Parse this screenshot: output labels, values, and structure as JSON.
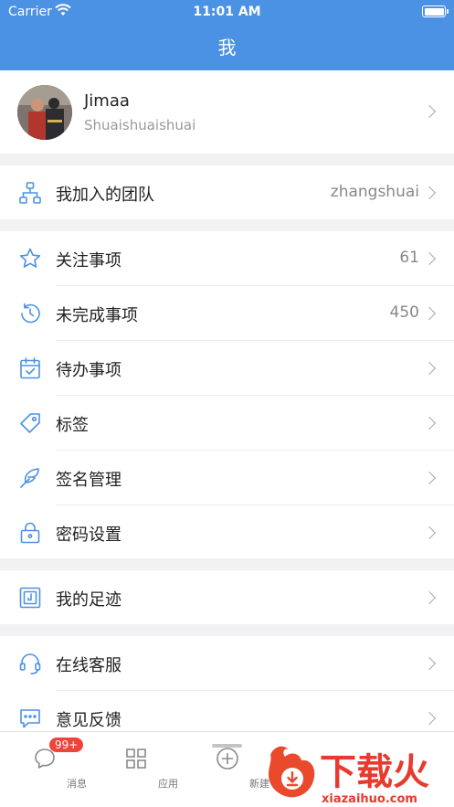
{
  "status_bar": {
    "carrier": "Carrier",
    "time": "11:01 AM"
  },
  "nav": {
    "title": "我"
  },
  "profile": {
    "name": "Jimaa",
    "subtitle": "Shuaishuaishuai"
  },
  "team": {
    "label": "我加入的团队",
    "value": "zhangshuai",
    "icon": "team-tree-icon"
  },
  "group1": [
    {
      "label": "关注事项",
      "value": "61",
      "icon": "star-icon"
    },
    {
      "label": "未完成事项",
      "value": "450",
      "icon": "history-clock-icon"
    },
    {
      "label": "待办事项",
      "value": "",
      "icon": "calendar-check-icon"
    },
    {
      "label": "标签",
      "value": "",
      "icon": "tag-icon"
    },
    {
      "label": "签名管理",
      "value": "",
      "icon": "signature-feather-icon"
    },
    {
      "label": "密码设置",
      "value": "",
      "icon": "lock-icon"
    }
  ],
  "footprint": {
    "label": "我的足迹",
    "icon": "footprint-icon"
  },
  "group2": [
    {
      "label": "在线客服",
      "icon": "headset-icon"
    },
    {
      "label": "意见反馈",
      "icon": "feedback-chat-icon"
    }
  ],
  "tabbar": {
    "messages": {
      "label": "消息",
      "badge": "99+"
    },
    "apps": {
      "label": "应用"
    },
    "create": {
      "label": "新建"
    }
  },
  "watermark": {
    "cn": "下载火",
    "en": "xiazaihuo.com"
  },
  "colors": {
    "header": "#4c92e4",
    "icon": "#4c92e4",
    "badge": "#f0443b",
    "watermark": "#e83a2e"
  }
}
